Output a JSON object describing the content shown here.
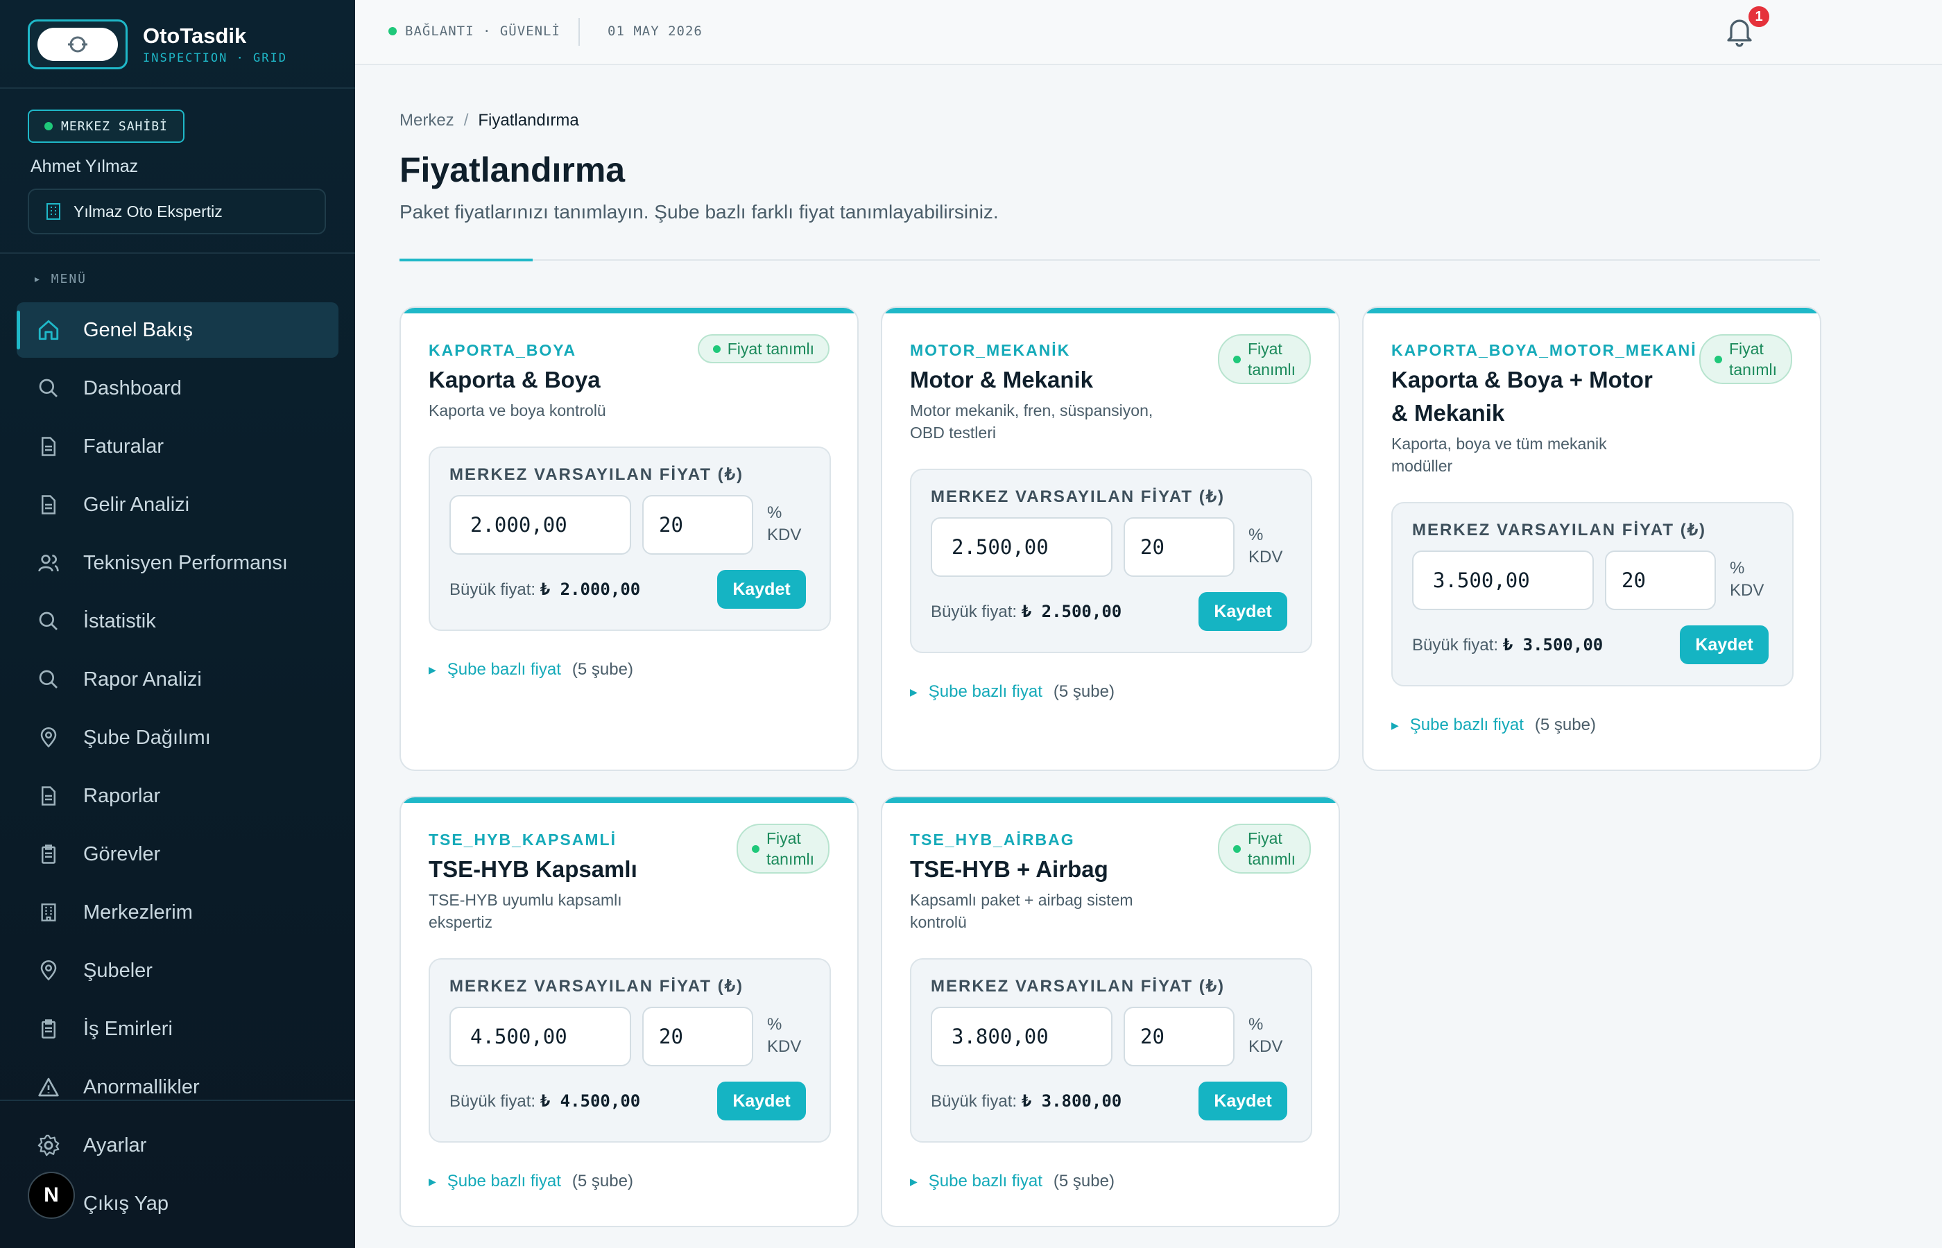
{
  "brand": {
    "name": "OtoTasdik",
    "subtitle": "INSPECTION · GRID"
  },
  "user": {
    "role": "MERKEZ SAHİBİ",
    "name": "Ahmet Yılmaz",
    "center": "Yılmaz Oto Ekspertiz"
  },
  "menu_label": "▸ MENÜ",
  "nav": [
    {
      "label": "Genel Bakış",
      "icon": "home-icon",
      "active": true
    },
    {
      "label": "Dashboard",
      "icon": "search-icon"
    },
    {
      "label": "Faturalar",
      "icon": "document-icon"
    },
    {
      "label": "Gelir Analizi",
      "icon": "document-icon"
    },
    {
      "label": "Teknisyen Performansı",
      "icon": "users-icon"
    },
    {
      "label": "İstatistik",
      "icon": "search-icon"
    },
    {
      "label": "Rapor Analizi",
      "icon": "search-icon"
    },
    {
      "label": "Şube Dağılımı",
      "icon": "location-pin-icon"
    },
    {
      "label": "Raporlar",
      "icon": "document-icon"
    },
    {
      "label": "Görevler",
      "icon": "clipboard-icon"
    },
    {
      "label": "Merkezlerim",
      "icon": "building-icon"
    },
    {
      "label": "Şubeler",
      "icon": "location-pin-icon"
    },
    {
      "label": "İş Emirleri",
      "icon": "clipboard-icon"
    },
    {
      "label": "Anormallikler",
      "icon": "warning-icon"
    }
  ],
  "bottom_nav": [
    {
      "label": "Ayarlar",
      "icon": "gear-icon"
    },
    {
      "label": "Çıkış Yap",
      "icon": "logout-icon"
    }
  ],
  "next_badge": "N",
  "topbar": {
    "connection": "BAĞLANTI · GÜVENLİ",
    "date": "01 MAY 2026",
    "notification_count": "1"
  },
  "breadcrumb": {
    "root": "Merkez",
    "sep": "/",
    "current": "Fiyatlandırma"
  },
  "page": {
    "title": "Fiyatlandırma",
    "description": "Paket fiyatlarınızı tanımlayın. Şube bazlı farklı fiyat tanımlayabilirsiniz."
  },
  "labels": {
    "price_label": "MERKEZ VARSAYILAN FİYAT (₺)",
    "kdv_percent": "%",
    "kdv": "KDV",
    "big_price": "Büyük fiyat:",
    "save": "Kaydet",
    "branch_price": "Şube bazlı fiyat",
    "status": "Fiyat tanımlı",
    "status_line1": "Fiyat",
    "status_line2": "tanımlı"
  },
  "packages": [
    {
      "code": "KAPORTA_BOYA",
      "name": "Kaporta & Boya",
      "description": "Kaporta ve boya kontrolü",
      "price": "2.000,00",
      "kdv": "20",
      "big_price": "₺ 2.000,00",
      "branches": "(5 şube)"
    },
    {
      "code": "MOTOR_MEKANİK",
      "name": "Motor & Mekanik",
      "description_1": "Motor mekanik, fren, süspansiyon,",
      "description_2": "OBD testleri",
      "price": "2.500,00",
      "kdv": "20",
      "big_price": "₺ 2.500,00",
      "branches": "(5 şube)"
    },
    {
      "code": "KAPORTA_BOYA_MOTOR_MEKANİK",
      "name_1": "Kaporta & Boya + Motor",
      "name_2": "& Mekanik",
      "description_1": "Kaporta, boya ve tüm mekanik",
      "description_2": "modüller",
      "price": "3.500,00",
      "kdv": "20",
      "big_price": "₺ 3.500,00",
      "branches": "(5 şube)"
    },
    {
      "code": "TSE_HYB_KAPSAMLİ",
      "name": "TSE-HYB Kapsamlı",
      "description_1": "TSE-HYB uyumlu kapsamlı",
      "description_2": "ekspertiz",
      "price": "4.500,00",
      "kdv": "20",
      "big_price": "₺ 4.500,00",
      "branches": "(5 şube)"
    },
    {
      "code": "TSE_HYB_AİRBAG",
      "name": "TSE-HYB + Airbag",
      "description_1": "Kapsamlı paket + airbag sistem",
      "description_2": "kontrolü",
      "price": "3.800,00",
      "kdv": "20",
      "big_price": "₺ 3.800,00",
      "branches": "(5 şube)"
    }
  ],
  "colors": {
    "accent": "#1fb8c8",
    "sidebar_bg": "#0b2230",
    "success": "#1b8a5b",
    "badge_red": "#e5323b"
  }
}
